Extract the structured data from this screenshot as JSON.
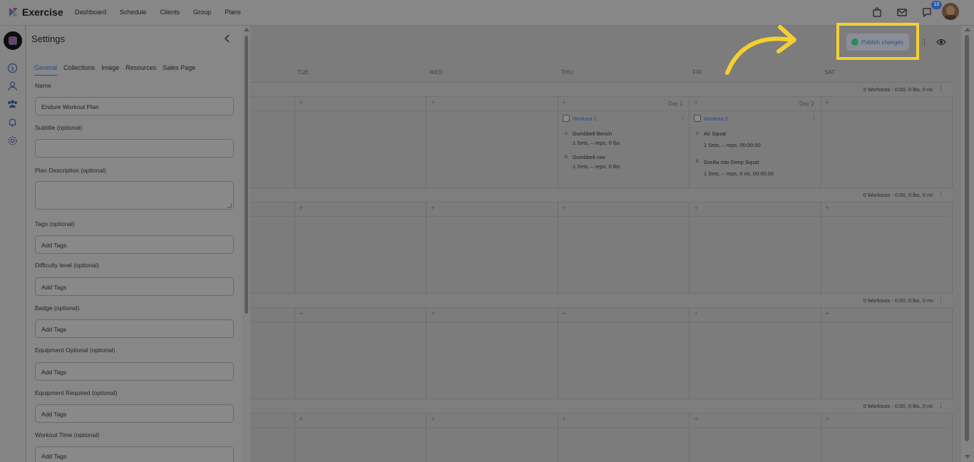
{
  "brand": {
    "name": "Exercise"
  },
  "nav": {
    "items": [
      "Dashboard",
      "Schedule",
      "Clients",
      "Group",
      "Plans"
    ]
  },
  "header": {
    "notification_count": "10"
  },
  "settings": {
    "title": "Settings",
    "tabs": [
      "General",
      "Collections",
      "Image",
      "Resources",
      "Sales Page"
    ],
    "fields": {
      "name_label": "Name",
      "name_value": "Endure Workout Plan",
      "subtitle_label": "Subtitle (optional)",
      "description_label": "Plan Description (optional)",
      "tags_label": "Tags (optional)",
      "tags_placeholder": "Add Tags",
      "difficulty_label": "Difficulty level (optional)",
      "difficulty_placeholder": "Add Tags",
      "badge_label": "Badge (optional)",
      "badge_placeholder": "Add Tags",
      "equipment_optional_label": "Equipment Optional (optional)",
      "equipment_optional_placeholder": "Add Tags",
      "equipment_required_label": "Equipment Required (optional)",
      "equipment_required_placeholder": "Add Tags",
      "workout_time_label": "Workout Time (optional)",
      "workout_time_placeholder": "Add Tags"
    }
  },
  "toolbar": {
    "publish_label": "Publish changes"
  },
  "calendar": {
    "day_headers": [
      "TUE",
      "WED",
      "THU",
      "FRI",
      "SAT"
    ],
    "weeks": [
      {
        "summary": "2 Workouts - 0:00, 0 lbs, 0 mi"
      },
      {
        "summary": "0 Workouts - 0:00, 0 lbs, 0 mi"
      },
      {
        "summary": "0 Workouts - 0:00, 0 lbs, 0 mi"
      },
      {
        "summary": "0 Workouts - 0:00, 0 lbs, 0 mi"
      }
    ],
    "day_labels": {
      "thu": "Day 1",
      "fri": "Day 2"
    },
    "workouts": [
      {
        "title": "Workout 1",
        "exercises": [
          {
            "letter": "A",
            "name": "Dumbbell Bench",
            "detail": "1 Sets, – reps, 0 lbs"
          },
          {
            "letter": "B",
            "name": "Dumbbell row",
            "detail": "1 Sets, – reps, 0 lbs"
          }
        ]
      },
      {
        "title": "Workout 2",
        "exercises": [
          {
            "letter": "A",
            "name": "Air Squat",
            "detail": "1 Sets, – reps, 00:00:00"
          },
          {
            "letter": "B",
            "name": "Gorilla into Deep Squat",
            "detail": "1 Sets, – reps, 0 mi, 00:00:00"
          }
        ]
      }
    ]
  },
  "colors": {
    "highlight": "#f4cf31",
    "accent": "#2f4e8a",
    "publish_dot": "#2a8b57"
  }
}
